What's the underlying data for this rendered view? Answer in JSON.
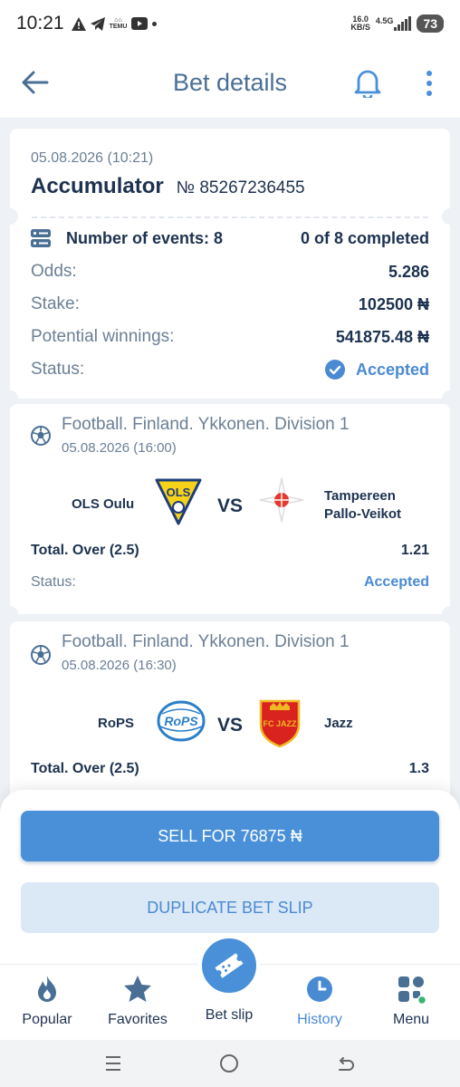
{
  "status_bar": {
    "time": "10:21",
    "net_speed_value": "16.0",
    "net_speed_unit": "KB/S",
    "network": "4.5G",
    "battery": "73",
    "temu_label": "TEMU"
  },
  "header": {
    "title": "Bet details"
  },
  "bet": {
    "date": "05.08.2026 (10:21)",
    "type": "Accumulator",
    "number_label": "№ 85267236455",
    "events_label": "Number of events: 8",
    "completed_label": "0 of 8 completed",
    "odds_label": "Odds:",
    "odds_value": "5.286",
    "stake_label": "Stake:",
    "stake_value": "102500 ₦",
    "winnings_label": "Potential winnings:",
    "winnings_value": "541875.48 ₦",
    "status_label": "Status:",
    "status_value": "Accepted"
  },
  "events": [
    {
      "league": "Football. Finland. Ykkonen. Division 1",
      "date": "05.08.2026 (16:00)",
      "home": "OLS Oulu",
      "away_line1": "Tampereen",
      "away_line2": "Pallo-Veikot",
      "vs": "VS",
      "market": "Total. Over (2.5)",
      "odds": "1.21",
      "status_label": "Status:",
      "status_value": "Accepted",
      "home_logo_text": "OLS"
    },
    {
      "league": "Football. Finland. Ykkonen. Division 1",
      "date": "05.08.2026 (16:30)",
      "home": "RoPS",
      "away": "Jazz",
      "vs": "VS",
      "market": "Total. Over (2.5)",
      "odds": "1.3",
      "home_logo_text": "RoPS",
      "away_logo_text": "FC JAZZ"
    }
  ],
  "actions": {
    "sell": "SELL FOR 76875 ₦",
    "duplicate": "DUPLICATE BET SLIP"
  },
  "tabs": {
    "popular": "Popular",
    "favorites": "Favorites",
    "bet_slip": "Bet slip",
    "history": "History",
    "menu": "Menu"
  },
  "colors": {
    "accent": "#4a90d9",
    "title": "#4a6f95",
    "text_dark": "#1d3250",
    "text_muted": "#6b7f96",
    "accepted": "#4a8ad2"
  }
}
